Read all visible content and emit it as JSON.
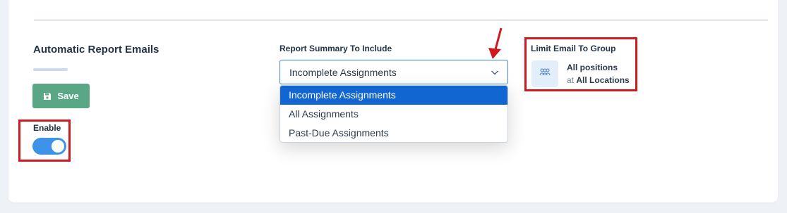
{
  "section": {
    "title": "Automatic Report Emails",
    "save_label": "Save",
    "enable_label": "Enable",
    "enabled": true
  },
  "report_summary": {
    "label": "Report Summary To Include",
    "selected_value": "Incomplete Assignments",
    "options": [
      "Incomplete Assignments",
      "All Assignments",
      "Past-Due Assignments"
    ]
  },
  "limit_group": {
    "label": "Limit Email To Group",
    "positions": "All positions",
    "at_prefix": "at",
    "locations": "All Locations"
  },
  "colors": {
    "save_button": "#5aa785",
    "toggle_on": "#3d93e8",
    "selected_option": "#1266d2",
    "annotation_red": "#d0191e"
  },
  "icons": {
    "save": "floppy-disk-icon",
    "chevron": "chevron-down-icon",
    "group": "group-users-icon"
  }
}
